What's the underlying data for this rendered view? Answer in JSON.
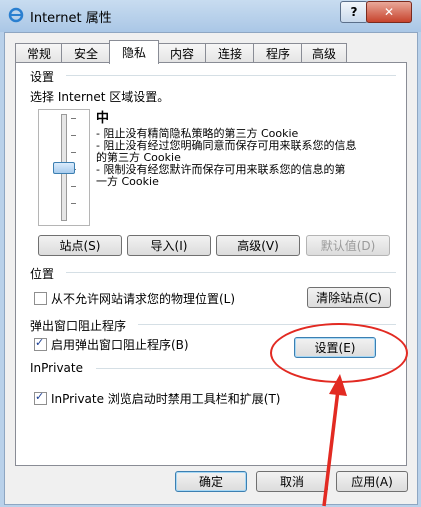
{
  "window": {
    "title": "Internet 属性",
    "help_symbol": "?",
    "close_symbol": "✕"
  },
  "tabs": [
    {
      "label": "常规"
    },
    {
      "label": "安全"
    },
    {
      "label": "隐私"
    },
    {
      "label": "内容"
    },
    {
      "label": "连接"
    },
    {
      "label": "程序"
    },
    {
      "label": "高级"
    }
  ],
  "active_tab": "隐私",
  "settings": {
    "group_label": "设置",
    "instruction": "选择 Internet 区域设置。",
    "level_title": "中",
    "level_fraction": 0.5,
    "descriptions": [
      "- 阻止没有精简隐私策略的第三方 Cookie",
      "- 阻止没有经过您明确同意而保存可用来联系您的信息",
      "的第三方 Cookie",
      "- 限制没有经您默许而保存可用来联系您的信息的第",
      "一方 Cookie"
    ],
    "buttons": {
      "sites": "站点(S)",
      "import": "导入(I)",
      "advanced": "高级(V)",
      "default": "默认值(D)"
    }
  },
  "location": {
    "group_label": "位置",
    "checkbox_label": "从不允许网站请求您的物理位置(L)",
    "checked": false,
    "clear_button": "清除站点(C)"
  },
  "popup": {
    "group_label": "弹出窗口阻止程序",
    "checkbox_label": "启用弹出窗口阻止程序(B)",
    "checked": true,
    "settings_button": "设置(E)"
  },
  "inprivate": {
    "group_label": "InPrivate",
    "checkbox_label": "InPrivate 浏览启动时禁用工具栏和扩展(T)",
    "checked": true
  },
  "footer": {
    "ok": "确定",
    "cancel": "取消",
    "apply": "应用(A)"
  },
  "colors": {
    "annotation": "#e22a22"
  }
}
